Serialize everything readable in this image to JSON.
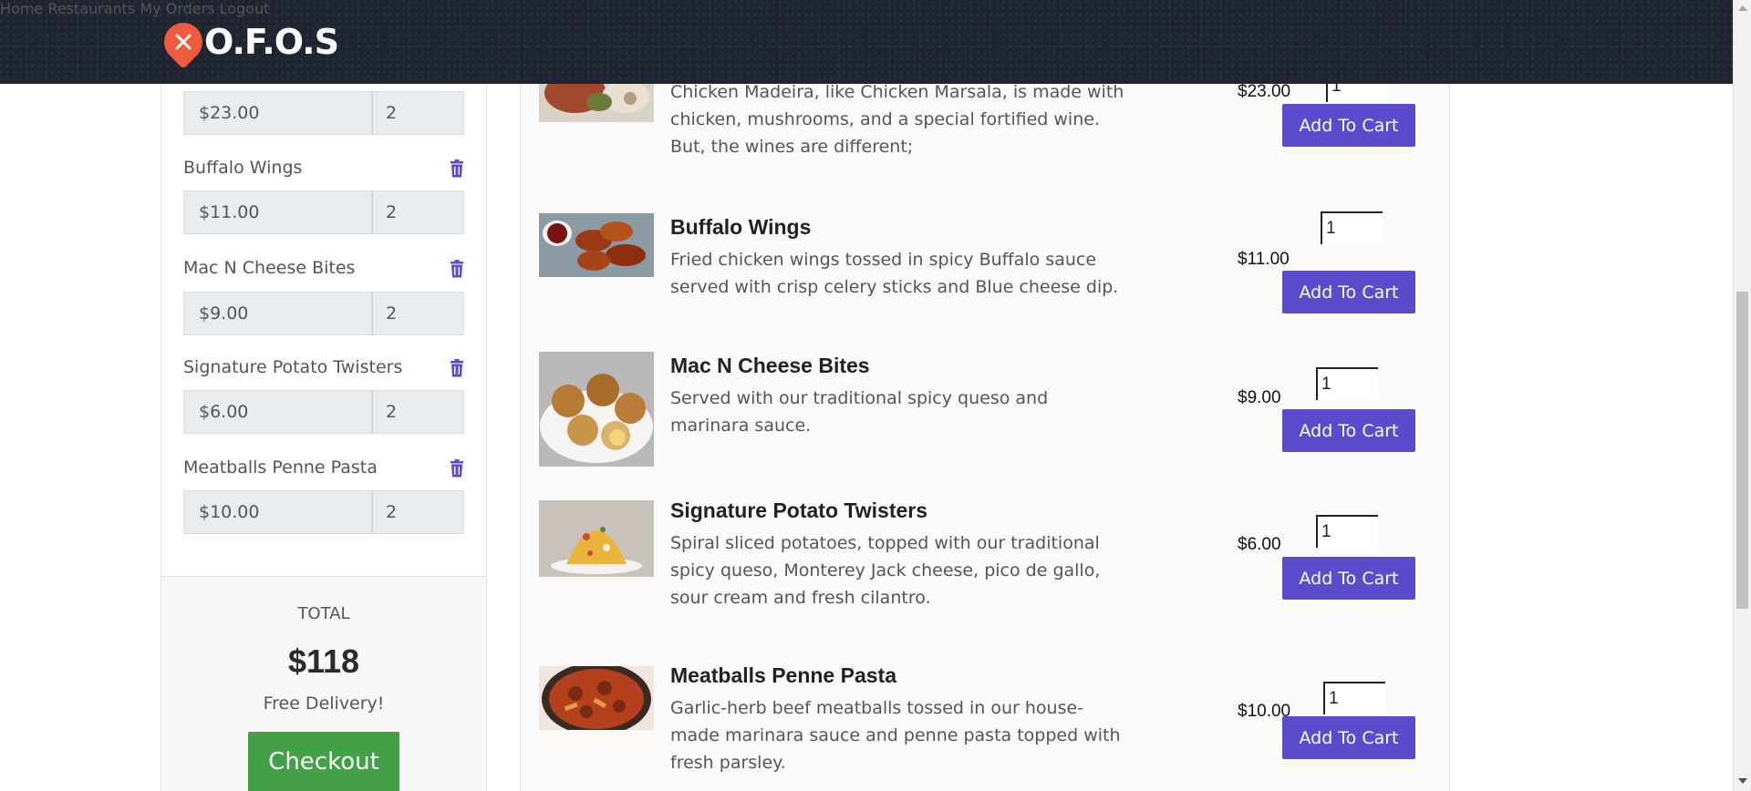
{
  "brand": {
    "name": "O.F.O.S"
  },
  "nav": {
    "home": "Home",
    "restaurants": "Restaurants",
    "my_orders": "My Orders",
    "logout": "Logout"
  },
  "cart": {
    "first_row": {
      "price": "$23.00",
      "qty": "2"
    },
    "items": [
      {
        "name": "Buffalo Wings",
        "price": "$11.00",
        "qty": "2"
      },
      {
        "name": "Mac N Cheese Bites",
        "price": "$9.00",
        "qty": "2"
      },
      {
        "name": "Signature Potato Twisters",
        "price": "$6.00",
        "qty": "2"
      },
      {
        "name": "Meatballs Penne Pasta",
        "price": "$10.00",
        "qty": "2"
      }
    ],
    "total_label": "TOTAL",
    "total_amount": "$118",
    "delivery_note": "Free Delivery!",
    "checkout_label": "Checkout"
  },
  "menu": {
    "add_label": "Add To Cart",
    "items": [
      {
        "title": "",
        "description": "Chicken Madeira, like Chicken Marsala, is made with chicken, mushrooms, and a special fortified wine. But, the wines are different;",
        "price": "$23.00",
        "qty": "1"
      },
      {
        "title": "Buffalo Wings",
        "description": "Fried chicken wings tossed in spicy Buffalo sauce served with crisp celery sticks and Blue cheese dip.",
        "price": "$11.00",
        "qty": "1"
      },
      {
        "title": "Mac N Cheese Bites",
        "description": "Served with our traditional spicy queso and marinara sauce.",
        "price": "$9.00",
        "qty": "1"
      },
      {
        "title": "Signature Potato Twisters",
        "description": "Spiral sliced potatoes, topped with our traditional spicy queso, Monterey Jack cheese, pico de gallo, sour cream and fresh cilantro.",
        "price": "$6.00",
        "qty": "1"
      },
      {
        "title": "Meatballs Penne Pasta",
        "description": "Garlic-herb beef meatballs tossed in our house-made marinara sauce and penne pasta topped with fresh parsley.",
        "price": "$10.00",
        "qty": "1"
      }
    ]
  },
  "colors": {
    "header_bg": "#1e2430",
    "brand_orange": "#ef5b3e",
    "add_button": "#5c4ccd",
    "checkout_button": "#43a047",
    "trash_icon": "#5c4ccd"
  },
  "icons": {
    "logo": "map-pin-utensils-icon",
    "remove": "trash-icon"
  }
}
